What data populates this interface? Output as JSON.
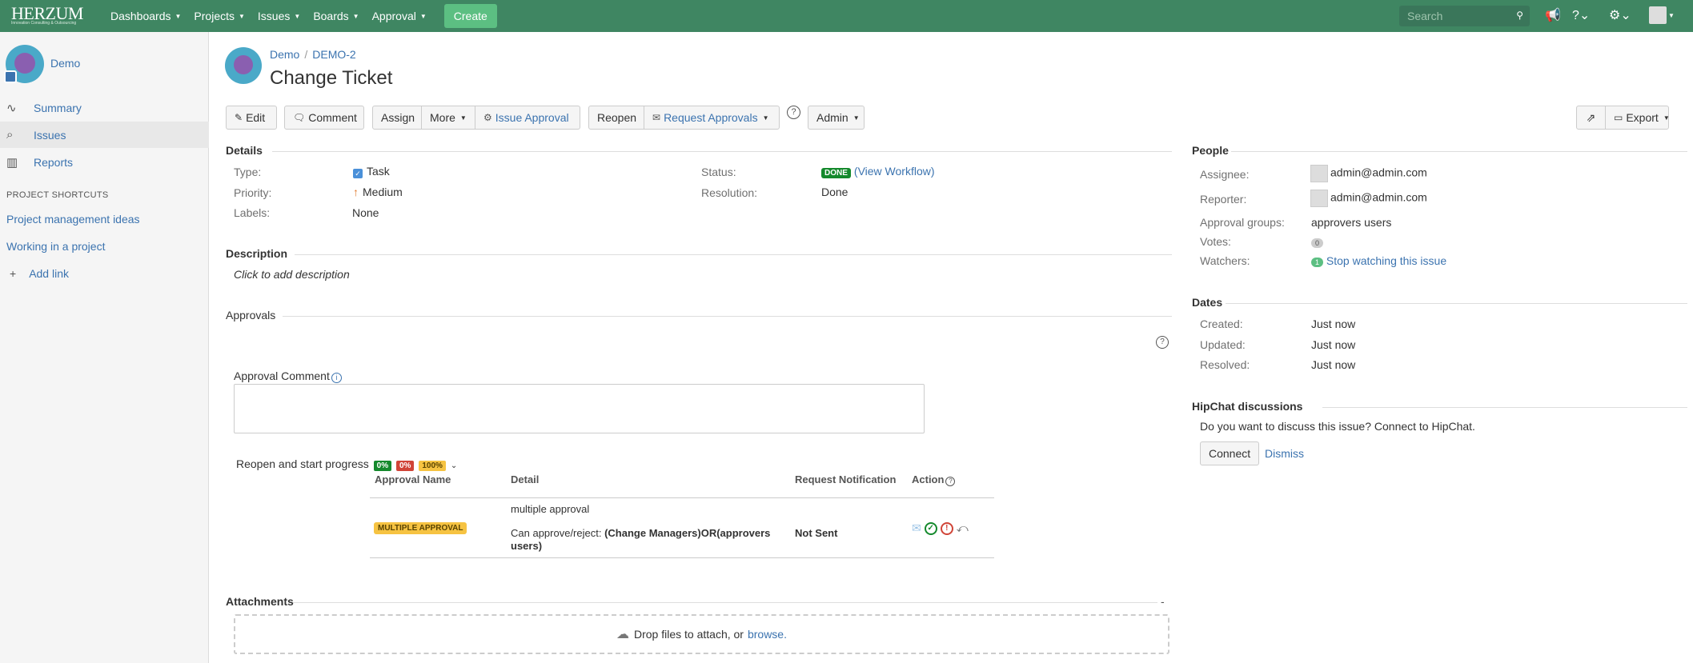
{
  "topbar": {
    "logo_text": "HERZUM",
    "logo_tagline": "Innovation Consulting & Outsourcing",
    "nav": [
      "Dashboards",
      "Projects",
      "Issues",
      "Boards",
      "Approval"
    ],
    "create_label": "Create",
    "search_placeholder": "Search",
    "bg_color": "#3f8662"
  },
  "sidebar": {
    "project_name": "Demo",
    "items": [
      {
        "label": "Summary",
        "icon": "pulse-icon"
      },
      {
        "label": "Issues",
        "icon": "issues-icon"
      },
      {
        "label": "Reports",
        "icon": "reports-icon"
      }
    ],
    "shortcuts_heading": "PROJECT SHORTCUTS",
    "shortcuts": [
      "Project management ideas",
      "Working in a project"
    ],
    "add_link": "Add link"
  },
  "header": {
    "breadcrumb": [
      "Demo",
      "DEMO-2"
    ],
    "title": "Change Ticket"
  },
  "toolbar": {
    "edit": "Edit",
    "comment": "Comment",
    "assign": "Assign",
    "more": "More",
    "issue_approval": "Issue Approval",
    "reopen": "Reopen",
    "request_approvals": "Request Approvals",
    "admin": "Admin",
    "export": "Export"
  },
  "details": {
    "heading": "Details",
    "type_label": "Type:",
    "type_value": "Task",
    "priority_label": "Priority:",
    "priority_value": "Medium",
    "labels_label": "Labels:",
    "labels_value": "None",
    "status_label": "Status:",
    "status_value": "DONE",
    "view_workflow": "(View Workflow)",
    "resolution_label": "Resolution:",
    "resolution_value": "Done"
  },
  "description": {
    "heading": "Description",
    "placeholder": "Click to add description"
  },
  "approvals": {
    "heading": "Approvals",
    "comment_label": "Approval Comment",
    "transition_label": "Reopen and start progress",
    "pct_green": "0%",
    "pct_red": "0%",
    "pct_yellow": "100%",
    "columns": [
      "Approval Name",
      "Detail",
      "Request Notification",
      "Action"
    ],
    "row": {
      "name": "MULTIPLE APPROVAL",
      "detail_title": "multiple approval",
      "detail_prefix": "Can approve/reject:",
      "detail_groups_1": "(Change Managers)OR(approvers",
      "detail_groups_2": "users)",
      "notification": "Not Sent"
    }
  },
  "attachments": {
    "heading": "Attachments",
    "drop_text": "Drop files to attach, or",
    "browse": "browse."
  },
  "people": {
    "heading": "People",
    "assignee_label": "Assignee:",
    "assignee_value": "admin@admin.com",
    "reporter_label": "Reporter:",
    "reporter_value": "admin@admin.com",
    "approval_groups_label": "Approval groups:",
    "approval_groups_value": "approvers users",
    "votes_label": "Votes:",
    "votes_value": "0",
    "watchers_label": "Watchers:",
    "watchers_count": "1",
    "watchers_link": "Stop watching this issue"
  },
  "dates": {
    "heading": "Dates",
    "created_label": "Created:",
    "created_value": "Just now",
    "updated_label": "Updated:",
    "updated_value": "Just now",
    "resolved_label": "Resolved:",
    "resolved_value": "Just now"
  },
  "hipchat": {
    "heading": "HipChat discussions",
    "text": "Do you want to discuss this issue? Connect to HipChat.",
    "connect": "Connect",
    "dismiss": "Dismiss"
  }
}
